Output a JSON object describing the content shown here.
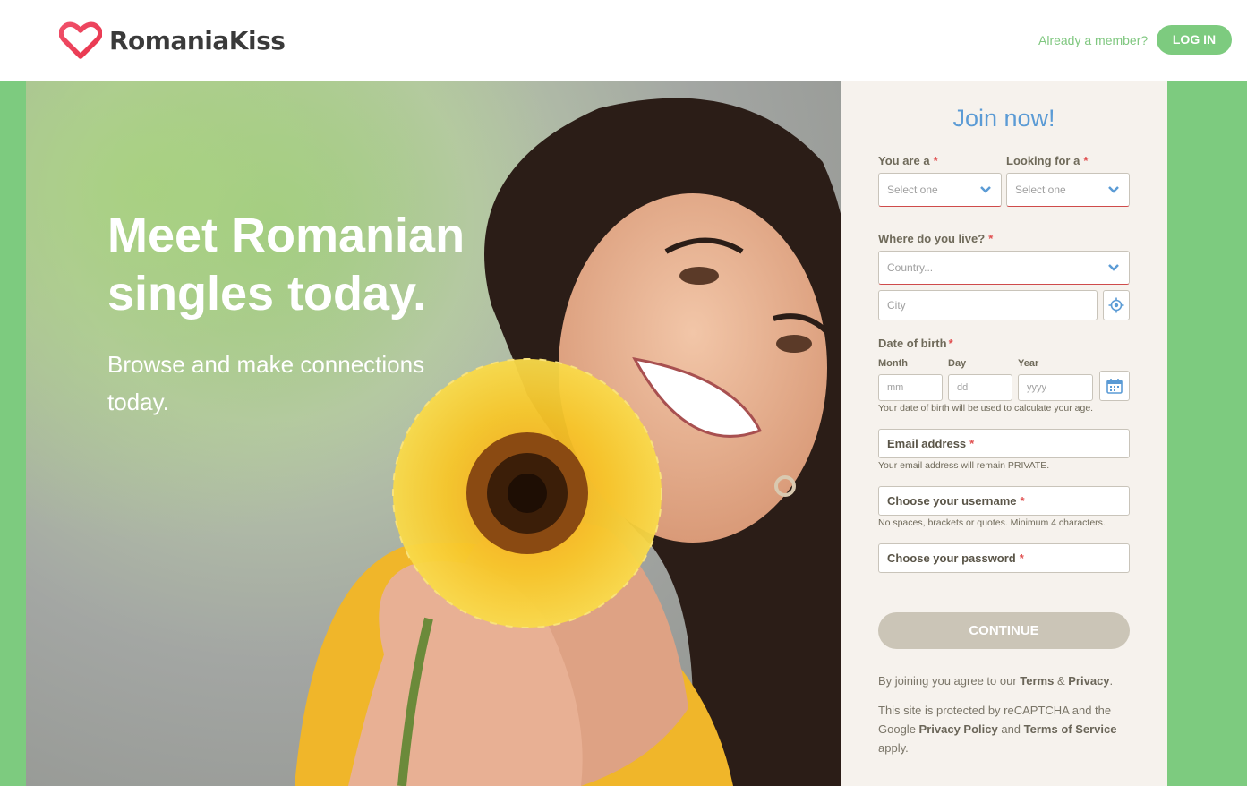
{
  "header": {
    "brand": "RomaniaKiss",
    "already_member": "Already a member?",
    "login_label": "LOG IN"
  },
  "hero": {
    "title": "Meet Romanian singles today.",
    "subtitle": "Browse and make connections today."
  },
  "form": {
    "title": "Join now!",
    "you_are_label": "You are a",
    "looking_for_label": "Looking for a",
    "you_are_value": "Select one",
    "looking_for_value": "Select one",
    "where_live_label": "Where do you live?",
    "country_placeholder": "Country...",
    "city_placeholder": "City",
    "dob_label": "Date of birth",
    "month_label": "Month",
    "day_label": "Day",
    "year_label": "Year",
    "month_placeholder": "mm",
    "day_placeholder": "dd",
    "year_placeholder": "yyyy",
    "dob_hint": "Your date of birth will be used to calculate your age.",
    "email_label": "Email address",
    "email_hint": "Your email address will remain PRIVATE.",
    "username_label": "Choose your username",
    "username_hint": "No spaces, brackets or quotes. Minimum 4 characters.",
    "password_label": "Choose your password",
    "required_mark": "*",
    "continue_label": "CONTINUE"
  },
  "legal": {
    "agree_prefix": "By joining you agree to our",
    "terms": "Terms",
    "amp": "&",
    "privacy": "Privacy",
    "period": ".",
    "recaptcha_prefix": "This site is protected by reCAPTCHA and the Google",
    "privacy_policy": "Privacy Policy",
    "and": "and",
    "terms_of_service": "Terms of Service",
    "apply": "apply."
  },
  "colors": {
    "brand_green": "#7dcb7f",
    "accent_blue": "#5b9bd5",
    "logo_red": "#e8334a",
    "required_red": "#e05050"
  }
}
